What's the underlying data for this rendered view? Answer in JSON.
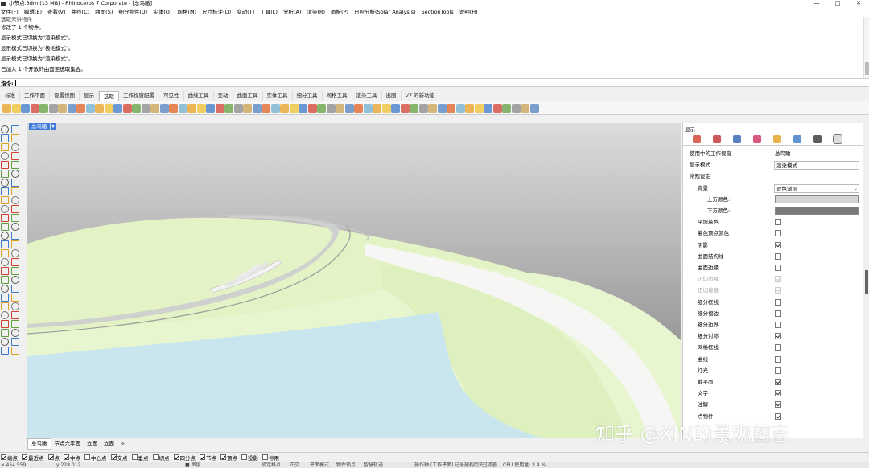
{
  "titlebar": {
    "title": "小节点.3dm (13 MB) - Rhinoceros 7 Corporate - [总鸟瞰]",
    "minimize": "—",
    "maximize": "□",
    "close": "✕"
  },
  "menu": [
    "文件(F)",
    "编辑(E)",
    "查看(V)",
    "曲线(C)",
    "曲面(S)",
    "细分物件(U)",
    "实体(O)",
    "网格(M)",
    "尺寸标注(D)",
    "变动(T)",
    "工具(L)",
    "分析(A)",
    "渲染(R)",
    "面板(P)",
    "日照分析(Solar Analysis)",
    "SectionTools",
    "说明(H)"
  ],
  "command_history": [
    "选取未讲物件",
    "修改了 1 个物件。",
    "显示模式已切换为\"渲染模式\"。",
    "显示模式已切换为\"极地模式\"。",
    "显示模式已切换为\"渲染模式\"。",
    "已加入 1 个开放的曲面至选取集合。"
  ],
  "command_prompt": "指令:",
  "toolbar_tabs": [
    "标准",
    "工作平面",
    "设置视图",
    "显示",
    "选取",
    "工作视窗配置",
    "可见性",
    "曲线工具",
    "变动",
    "曲面工具",
    "实体工具",
    "细分工具",
    "网格工具",
    "渲染工具",
    "出图",
    "V7 的新功能"
  ],
  "active_toolbar_tab": "选取",
  "viewport": {
    "name": "总鸟瞰",
    "arrow": "▾"
  },
  "viewport_tabs": [
    "总鸟瞰",
    "节点六平面",
    "立面",
    "立面",
    "✧"
  ],
  "osnaps": [
    {
      "label": "端点",
      "on": true
    },
    {
      "label": "最近点",
      "on": true
    },
    {
      "label": "点",
      "on": true
    },
    {
      "label": "中点",
      "on": true
    },
    {
      "label": "中心点",
      "on": false
    },
    {
      "label": "交点",
      "on": true
    },
    {
      "label": "垂点",
      "on": false
    },
    {
      "label": "切点",
      "on": false
    },
    {
      "label": "四分点",
      "on": true
    },
    {
      "label": "节点",
      "on": true
    },
    {
      "label": "顶点",
      "on": true
    },
    {
      "label": "投影",
      "on": false
    },
    {
      "label": "停用",
      "on": false
    }
  ],
  "statusbar": [
    "x 454.559",
    "y 228.012",
    "■ 图层",
    "锁定格点",
    "正交",
    "平面模式",
    "物件锁点",
    "智慧轨迹",
    "操作轴 (工作平面)",
    "记录建构历史",
    "过滤器",
    "CPU 使用量: 3.4 %"
  ],
  "panel": {
    "title": "显示",
    "icons": [
      "color-wheel-icon",
      "material-icon",
      "environment-icon",
      "light-icon",
      "folder-icon",
      "render-settings-icon",
      "camera-icon",
      "display-icon"
    ],
    "rows": [
      {
        "key": "使用中的工作视窗",
        "value": "总鸟瞰",
        "type": "text",
        "indent": 8
      },
      {
        "key": "显示模式",
        "value": "渲染模式",
        "type": "select",
        "indent": 8
      },
      {
        "key": "常规设定",
        "type": "header",
        "indent": 8
      },
      {
        "key": "背景",
        "value": "双色渐层",
        "type": "select",
        "indent": 18
      },
      {
        "key": "上方颜色:",
        "type": "swatch",
        "color": "#d4d4d4",
        "indent": 30
      },
      {
        "key": "下方颜色:",
        "type": "swatch",
        "color": "#7a7a7a",
        "indent": 30
      },
      {
        "key": "平坦着色",
        "type": "checkbox",
        "on": false,
        "indent": 18
      },
      {
        "key": "着色顶点颜色",
        "type": "checkbox",
        "on": false,
        "indent": 18
      },
      {
        "key": "阴影",
        "type": "checkbox",
        "on": true,
        "indent": 18
      },
      {
        "key": "曲面结构线",
        "type": "checkbox",
        "on": false,
        "indent": 18
      },
      {
        "key": "曲面边缘",
        "type": "checkbox",
        "on": false,
        "indent": 18
      },
      {
        "key": "正切边缘",
        "type": "checkbox",
        "on": true,
        "dim": true,
        "indent": 18
      },
      {
        "key": "正切接缝",
        "type": "checkbox",
        "on": true,
        "dim": true,
        "indent": 18
      },
      {
        "key": "细分框线",
        "type": "checkbox",
        "on": false,
        "indent": 18
      },
      {
        "key": "细分褶边",
        "type": "checkbox",
        "on": false,
        "indent": 18
      },
      {
        "key": "细分边界",
        "type": "checkbox",
        "on": false,
        "indent": 18
      },
      {
        "key": "细分对称",
        "type": "checkbox",
        "on": true,
        "indent": 18
      },
      {
        "key": "网格框线",
        "type": "checkbox",
        "on": false,
        "indent": 18
      },
      {
        "key": "曲线",
        "type": "checkbox",
        "on": false,
        "indent": 18
      },
      {
        "key": "灯光",
        "type": "checkbox",
        "on": false,
        "indent": 18
      },
      {
        "key": "截平面",
        "type": "checkbox",
        "on": true,
        "indent": 18
      },
      {
        "key": "文字",
        "type": "checkbox",
        "on": true,
        "indent": 18
      },
      {
        "key": "注解",
        "type": "checkbox",
        "on": true,
        "indent": 18
      },
      {
        "key": "点物件",
        "type": "checkbox",
        "on": true,
        "indent": 18
      }
    ]
  },
  "watermark": "知乎 @XIN的景观图志"
}
